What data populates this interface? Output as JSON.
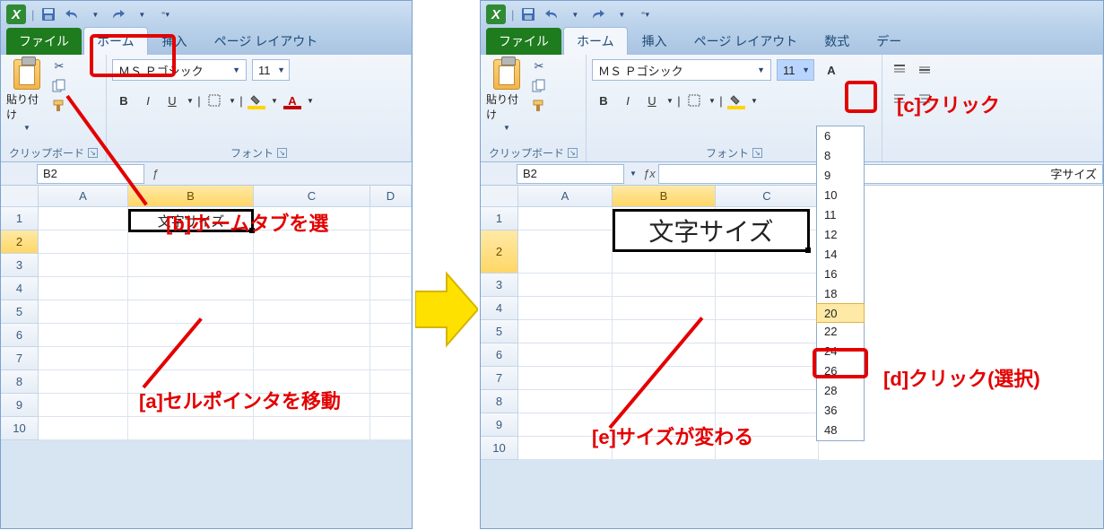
{
  "tabs": {
    "file": "ファイル",
    "home": "ホーム",
    "insert": "挿入",
    "layout": "ページ レイアウト",
    "formula": "数式",
    "data": "デー"
  },
  "clipboard": {
    "paste": "貼り付け",
    "group": "クリップボード"
  },
  "font": {
    "name": "ＭＳ Ｐゴシック",
    "size": "11",
    "group": "フォント",
    "bold": "B",
    "italic": "I",
    "underline": "U",
    "fill": "A",
    "color": "A"
  },
  "cell": {
    "ref": "B2",
    "value_small": "文字サイズ",
    "value_big": "文字サイズ",
    "formula_right": "字サイズ"
  },
  "cols": [
    "A",
    "B",
    "C",
    "D"
  ],
  "rows": [
    "1",
    "2",
    "3",
    "4",
    "5",
    "6",
    "7",
    "8",
    "9",
    "10"
  ],
  "sizes": [
    "6",
    "8",
    "9",
    "10",
    "11",
    "12",
    "14",
    "16",
    "18",
    "20",
    "22",
    "24",
    "26",
    "28",
    "36",
    "48"
  ],
  "size_selected": "20",
  "call": {
    "a": "[a]セルポインタを移動",
    "b": "[b]ホームタブを選",
    "c": "[c]クリック",
    "d": "[d]クリック(選択)",
    "e": "[e]サイズが変わる"
  }
}
